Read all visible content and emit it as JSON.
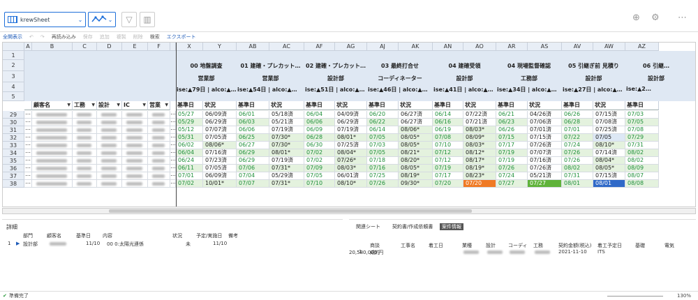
{
  "toolbar": {
    "sheet_name": "krewSheet",
    "items": [
      {
        "label": "全開表示",
        "state": "ac"
      },
      {
        "label": "↶",
        "state": "dis"
      },
      {
        "label": "↷",
        "state": "dis"
      },
      {
        "label": "再読み込み",
        "state": "n"
      },
      {
        "label": "保存",
        "state": "dis"
      },
      {
        "label": "追加",
        "state": "dis"
      },
      {
        "label": "複製",
        "state": "dis"
      },
      {
        "label": "削除",
        "state": "dis"
      },
      {
        "label": "検索",
        "state": "n"
      },
      {
        "label": "エクスポート",
        "state": "ac"
      }
    ]
  },
  "grid": {
    "left_cols": [
      "A",
      "B",
      "C",
      "D",
      "E",
      "F"
    ],
    "right_cols": [
      "X",
      "Y",
      "AB",
      "AC",
      "AF",
      "AG",
      "AJ",
      "AK",
      "AN",
      "AO",
      "AR",
      "AS",
      "AV",
      "AW",
      "AZ"
    ],
    "row_numbers": [
      "1",
      "2",
      "3",
      "4",
      "5",
      "29",
      "30",
      "31",
      "32",
      "33",
      "34",
      "35",
      "36",
      "37",
      "38"
    ],
    "left_fields": [
      "顧客名",
      "工務",
      "設計",
      "IC",
      "営業"
    ],
    "groups": [
      {
        "title": "00 地盤調査",
        "dept": "営業部",
        "stat": "ise:▲79日 | alco:▲…"
      },
      {
        "title": "01 建確・プレカット…",
        "dept": "営業部",
        "stat": "ise:▲54日 | alco:▲…"
      },
      {
        "title": "02 建確・プレカット…",
        "dept": "設計部",
        "stat": "ise:▲51日 | alco:▲…"
      },
      {
        "title": "03 最終打合せ",
        "dept": "コーディネーター",
        "stat": "ise:▲46日 | alco:▲…"
      },
      {
        "title": "04 建確受領",
        "dept": "設計部",
        "stat": "ise:▲41日 | alco:▲…"
      },
      {
        "title": "04 現場監督確認",
        "dept": "工務部",
        "stat": "ise:▲34日 | alco:▲…"
      },
      {
        "title": "05 引継ぎ前 見積り",
        "dept": "設計部",
        "stat": "ise:▲27日 | alco:▲…"
      },
      {
        "title": "06 引継…",
        "dept": "設計部",
        "stat": "ise:▲2…"
      }
    ],
    "sub_headers": [
      "基準日",
      "状況"
    ],
    "rows": [
      [
        "05/27",
        "06/09済",
        "06/01",
        "05/18済",
        "06/04",
        "04/09済",
        "06/20",
        "06/27済",
        "06/14",
        "07/22済",
        "06/21",
        "04/26済",
        "06/26",
        "07/15済",
        "07/03"
      ],
      [
        "05/29",
        "06/29済",
        "06/03",
        "05/21済",
        "06/06",
        "06/29済",
        "06/22",
        "06/27済",
        "06/16",
        "07/21済",
        "06/23",
        "07/06済",
        "06/28",
        "07/08済",
        "07/05"
      ],
      [
        "05/12",
        "07/07済",
        "06/06",
        "07/19済",
        "06/09",
        "07/19済",
        "06/14",
        "08/06*",
        "06/19",
        "08/03*",
        "06/26",
        "07/01済",
        "07/01",
        "07/25済",
        "07/08"
      ],
      [
        "05/31",
        "07/05済",
        "06/25",
        "07/30*",
        "06/28",
        "08/01*",
        "07/05",
        "08/05*",
        "07/08",
        "08/09*",
        "07/15",
        "07/15済",
        "07/22",
        "07/05",
        "07/29"
      ],
      [
        "06/02",
        "08/06*",
        "06/27",
        "07/30*",
        "06/30",
        "07/25済",
        "07/03",
        "08/05*",
        "07/10",
        "08/03*",
        "07/17",
        "07/26済",
        "07/24",
        "08/10*",
        "07/31"
      ],
      [
        "06/04",
        "07/16済",
        "06/29",
        "08/01*",
        "07/02",
        "08/04*",
        "07/05",
        "08/21*",
        "07/12",
        "08/12*",
        "07/19",
        "07/07済",
        "07/26",
        "07/14済",
        "08/02"
      ],
      [
        "06/24",
        "07/23済",
        "06/29",
        "07/19済",
        "07/02",
        "07/26*",
        "07/18",
        "08/20*",
        "07/12",
        "08/17*",
        "07/19",
        "07/16済",
        "07/26",
        "08/04*",
        "08/02"
      ],
      [
        "06/11",
        "07/05済",
        "07/06",
        "07/31*",
        "07/09",
        "08/03*",
        "07/16",
        "08/05*",
        "07/19",
        "08/19*",
        "07/26",
        "07/26済",
        "08/02",
        "08/05*",
        "08/09"
      ],
      [
        "07/01",
        "06/09済",
        "07/04",
        "05/29済",
        "07/05",
        "06/01済",
        "07/25",
        "08/19*",
        "07/17",
        "08/23*",
        "07/24",
        "05/21済",
        "07/31",
        "07/15済",
        "08/07"
      ],
      [
        "07/02",
        "10/01*",
        "07/07",
        "07/31*",
        "07/10",
        "08/10*",
        "07/26",
        "09/30*",
        "07/20",
        "07/20",
        "07/27",
        "07/27",
        "08/01",
        "08/01",
        "08/08"
      ]
    ]
  },
  "detail": {
    "title": "詳細",
    "headers": [
      "部門",
      "顧客名",
      "基準日",
      "内容",
      "状況",
      "予定/実施日",
      "備考"
    ],
    "row": [
      "1",
      "設計部",
      "",
      "11/10",
      "00 0:太陽光連係",
      "未",
      "11/10",
      ""
    ]
  },
  "related": {
    "tabs": [
      "関連シート",
      "契約書/作成依頼書",
      "案件情報"
    ],
    "headers": [
      "商談",
      "工事名",
      "着工日",
      "業種",
      "設計",
      "コーディ",
      "工務",
      "契約金額(税込)",
      "着工予定日",
      "基礎",
      "電気"
    ],
    "row": [
      "1",
      "成約",
      "上棟",
      "",
      "",
      "",
      "",
      "20,580,000 円",
      "2021-11-10",
      "ITS",
      ""
    ]
  },
  "status": {
    "text": "準備完了",
    "zoom": "130%"
  },
  "colors": {
    "green": "#e4f2de",
    "orange": "#f07a24",
    "greenfill": "#5fb33a",
    "blue": "#2f69c8",
    "lightblue": "#dde8f5"
  }
}
